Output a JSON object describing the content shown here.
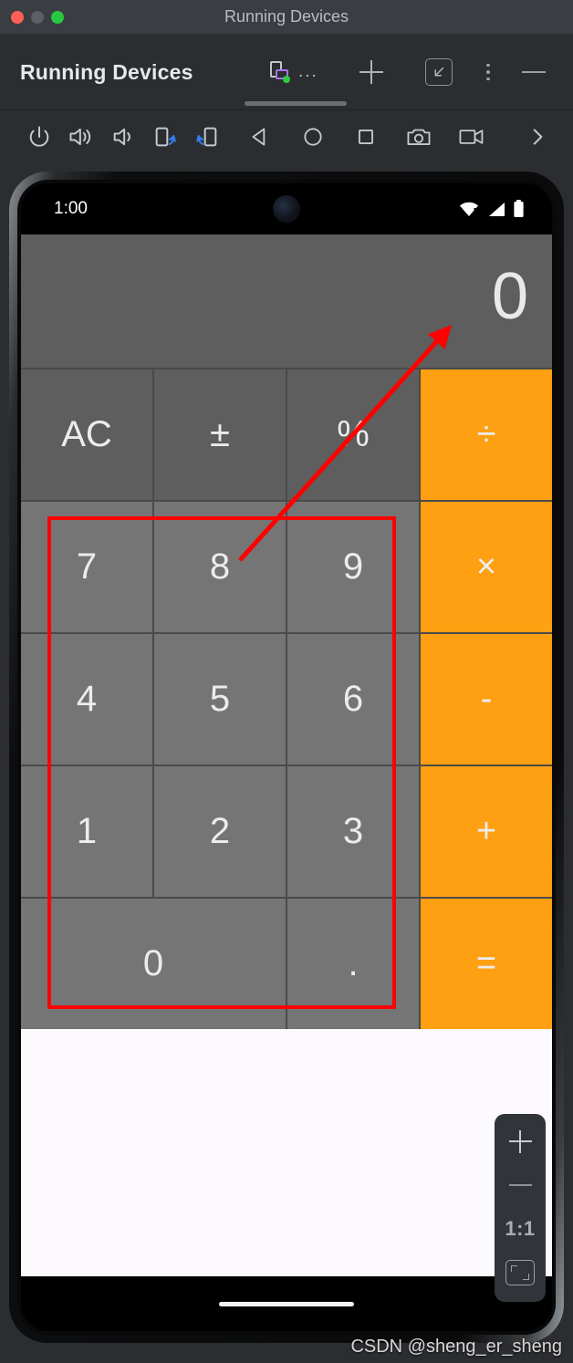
{
  "window": {
    "title": "Running Devices",
    "traffic_lights": [
      "close",
      "minimize",
      "zoom"
    ]
  },
  "tool_window": {
    "title": "Running Devices",
    "tab": {
      "label": "...",
      "device_icon": "device-emulator-icon",
      "running_indicator": "running-dot"
    },
    "actions": {
      "new_tab_label": "+",
      "dock_label": "",
      "more_label": "",
      "minimize_label": "—"
    }
  },
  "device_toolbar": {
    "icons": [
      {
        "name": "power-icon",
        "label": "Power"
      },
      {
        "name": "volume-up-icon",
        "label": "Volume Up"
      },
      {
        "name": "volume-down-icon",
        "label": "Volume Down"
      },
      {
        "name": "rotate-left-icon",
        "label": "Rotate Left"
      },
      {
        "name": "rotate-right-icon",
        "label": "Rotate Right"
      },
      {
        "name": "back-icon",
        "label": "Back"
      },
      {
        "name": "home-icon",
        "label": "Home"
      },
      {
        "name": "overview-icon",
        "label": "Overview"
      },
      {
        "name": "screenshot-icon",
        "label": "Take Screenshot"
      },
      {
        "name": "screen-record-icon",
        "label": "Record Screen"
      }
    ],
    "overflow_label": "›"
  },
  "device_screen": {
    "status_bar": {
      "time": "1:00",
      "icons": [
        "wifi-alert-icon",
        "signal-icon",
        "battery-icon"
      ]
    },
    "calculator": {
      "display_value": "0",
      "keys": [
        {
          "label": "AC",
          "type": "fn",
          "name": "key-all-clear"
        },
        {
          "label": "±",
          "type": "fn",
          "name": "key-plus-minus"
        },
        {
          "label": "%",
          "type": "fn",
          "name": "key-percent"
        },
        {
          "label": "÷",
          "type": "op",
          "name": "key-divide"
        },
        {
          "label": "7",
          "type": "num",
          "name": "key-7"
        },
        {
          "label": "8",
          "type": "num",
          "name": "key-8"
        },
        {
          "label": "9",
          "type": "num",
          "name": "key-9"
        },
        {
          "label": "×",
          "type": "op",
          "name": "key-multiply"
        },
        {
          "label": "4",
          "type": "num",
          "name": "key-4"
        },
        {
          "label": "5",
          "type": "num",
          "name": "key-5"
        },
        {
          "label": "6",
          "type": "num",
          "name": "key-6"
        },
        {
          "label": "-",
          "type": "op",
          "name": "key-minus"
        },
        {
          "label": "1",
          "type": "num",
          "name": "key-1"
        },
        {
          "label": "2",
          "type": "num",
          "name": "key-2"
        },
        {
          "label": "3",
          "type": "num",
          "name": "key-3"
        },
        {
          "label": "+",
          "type": "op",
          "name": "key-plus"
        },
        {
          "label": "0",
          "type": "num wide",
          "name": "key-0"
        },
        {
          "label": ".",
          "type": "num",
          "name": "key-decimal"
        },
        {
          "label": "=",
          "type": "op",
          "name": "key-equals"
        }
      ]
    },
    "gesture_bar": "home-indicator"
  },
  "zoom_controls": {
    "zoom_in_label": "+",
    "zoom_out_label": "—",
    "actual_size_label": "1:1",
    "fit_label": "fit-to-screen-icon"
  },
  "annotations": {
    "arrow": {
      "name": "red-arrow",
      "points_to": "display_value",
      "color": "#ff0000"
    },
    "rectangle": {
      "name": "red-highlight-rect",
      "surrounds": "number keys 0-9 and decimal",
      "color": "#ff0000"
    }
  },
  "watermark": "CSDN @sheng_er_sheng",
  "colors": {
    "operator_orange": "#FFA012",
    "key_gray": "#757575",
    "function_gray": "#5E5E5E",
    "annotation_red": "#FF0000",
    "running_green": "#2ECC40"
  }
}
